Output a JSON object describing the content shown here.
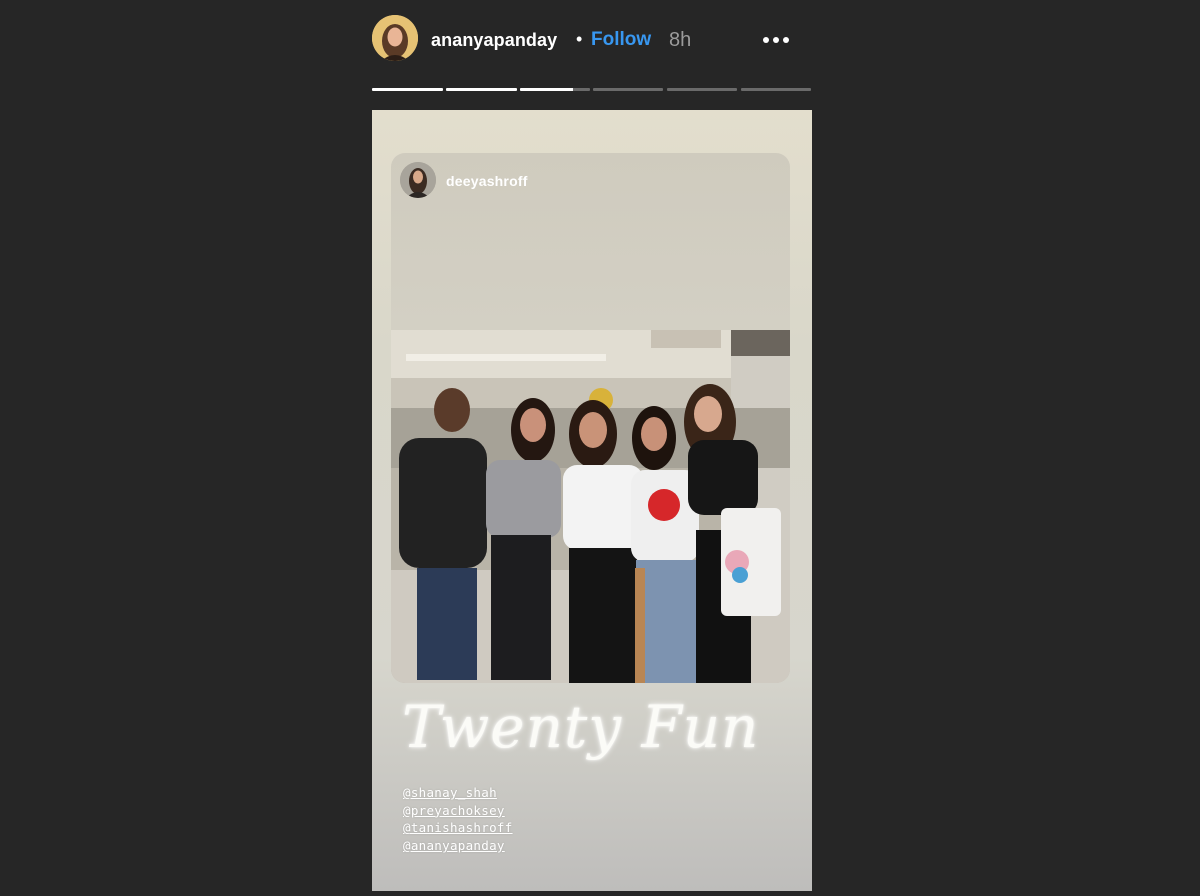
{
  "story_header": {
    "username": "ananyapanday",
    "separator": "•",
    "follow_label": "Follow",
    "time_ago": "8h",
    "more_icon": "more-horizontal-icon"
  },
  "progress": {
    "segments": [
      1,
      1,
      0.75,
      0,
      0,
      0
    ]
  },
  "shared_post": {
    "username": "deeyashroff"
  },
  "story": {
    "caption": "Twenty Fun",
    "mentions": [
      "@shanay_shah",
      "@preyachoksey",
      "@tanishashroff",
      "@ananyapanday"
    ]
  },
  "colors": {
    "background": "#262626",
    "follow": "#3897f0",
    "time": "#9b9b9b"
  }
}
